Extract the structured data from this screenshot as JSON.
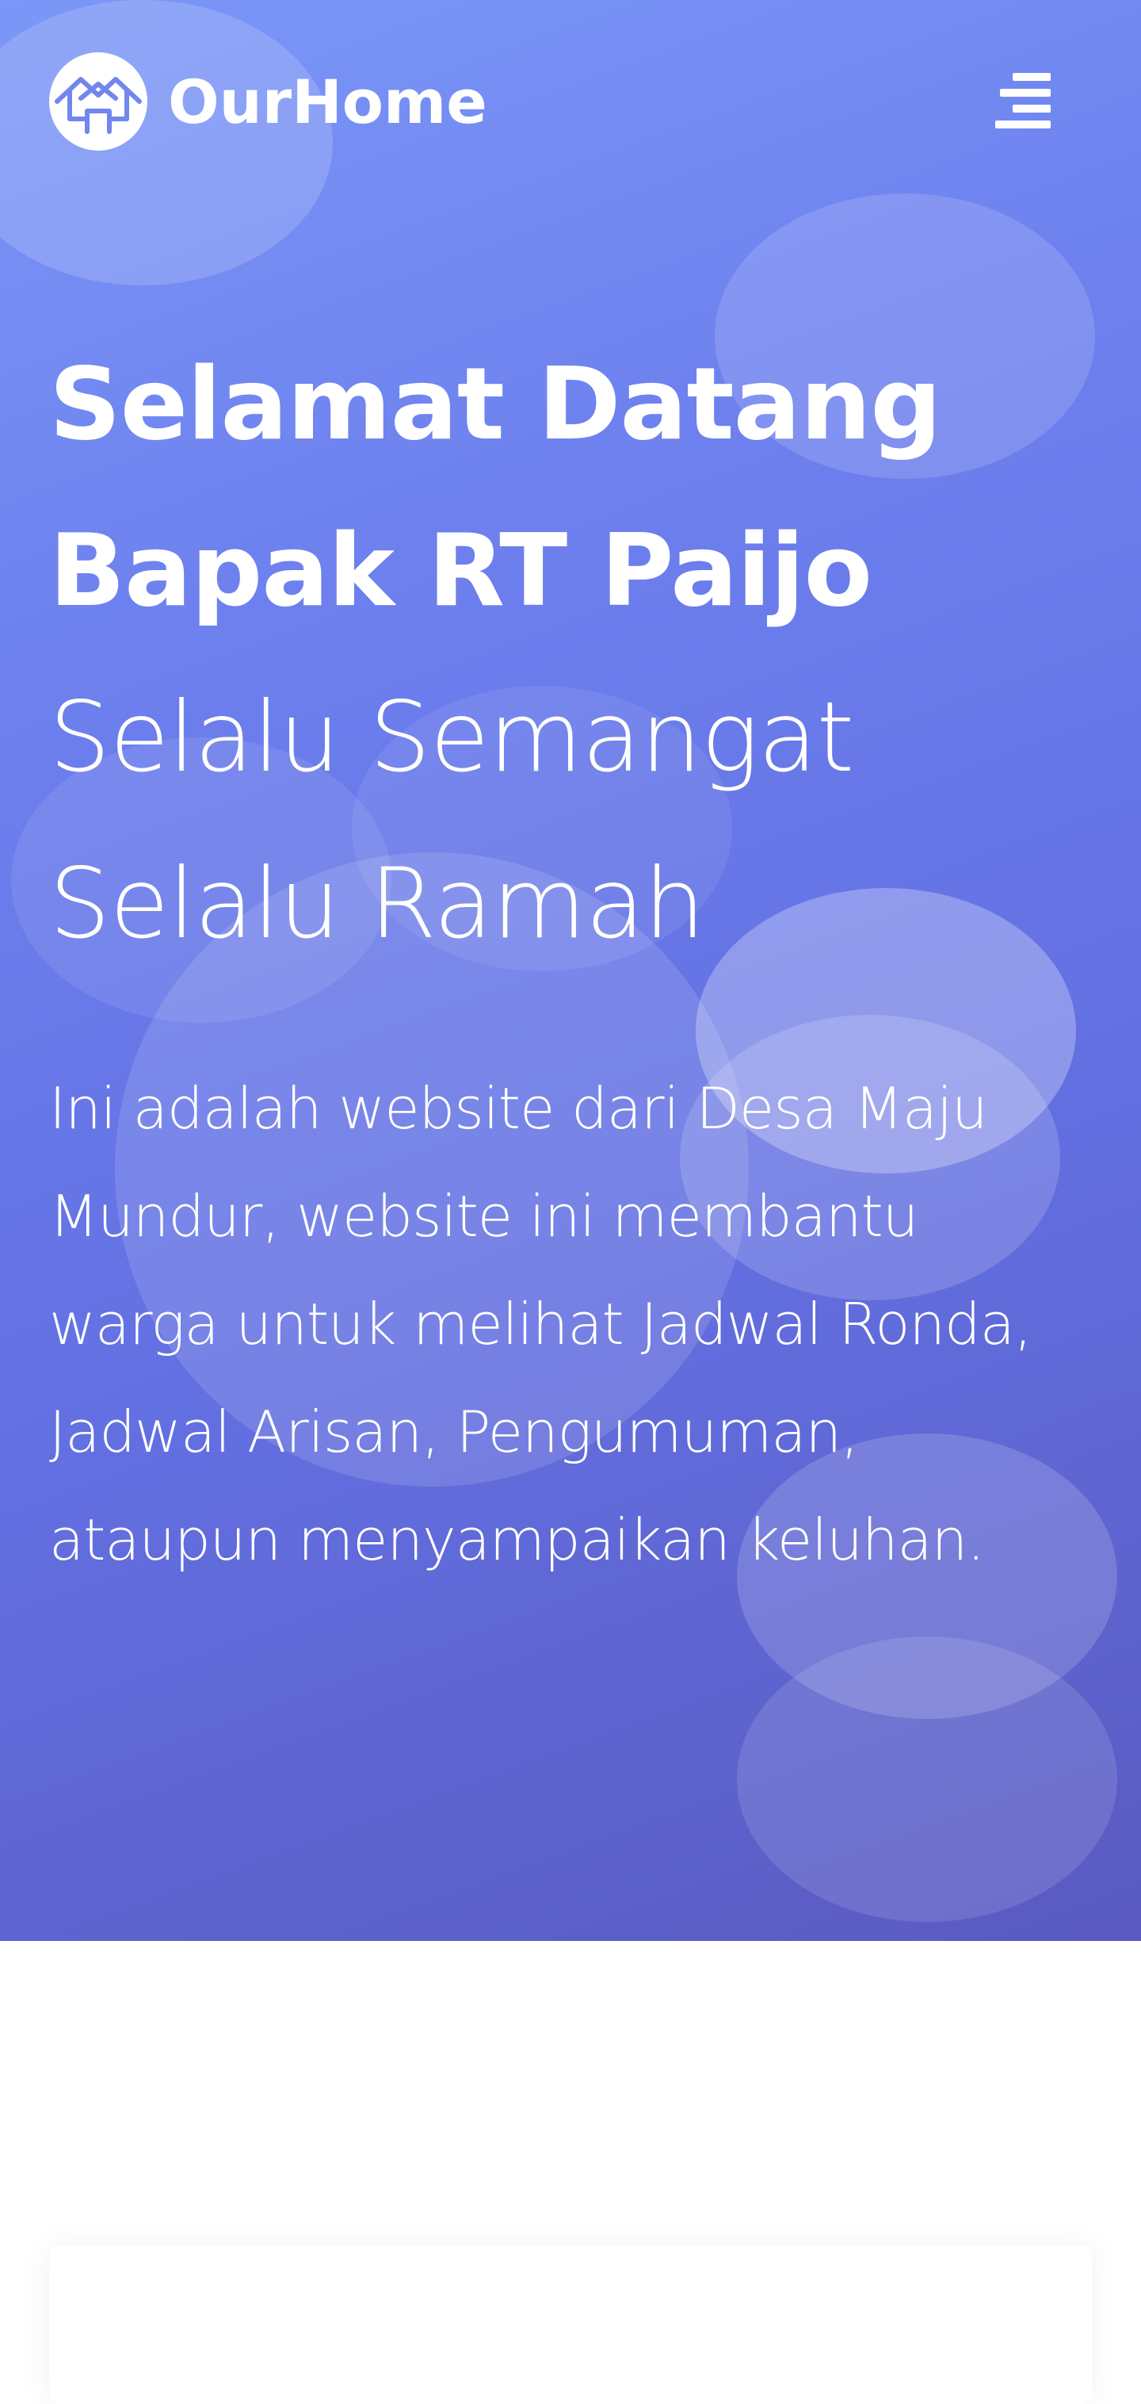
{
  "navbar": {
    "brand_name": "OurHome",
    "logo_icon": "house-roof-icon",
    "menu_icon": "hamburger-menu-icon"
  },
  "hero": {
    "headline_line1": "Selamat Datang",
    "headline_line2": "Bapak RT Paijo",
    "tagline_line1": "Selalu Semangat",
    "tagline_line2": "Selalu Ramah",
    "description": "Ini adalah website dari Desa Maju Mundur, website ini membantu warga untuk melihat Jadwal Ronda, Jadwal Arisan, Pengumuman, ataupun menyampaikan keluhan."
  },
  "colors": {
    "gradient_start": "#7b97f7",
    "gradient_end": "#5a5ac0",
    "text": "#ffffff",
    "page_background": "#ffffff"
  }
}
